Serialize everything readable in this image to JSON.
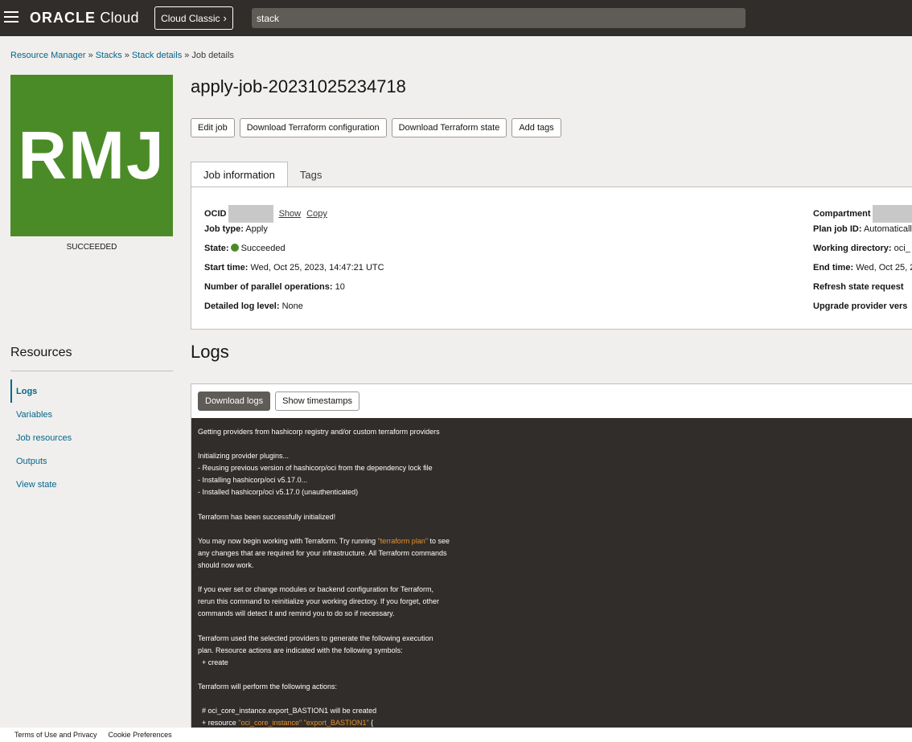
{
  "topbar": {
    "menu_icon": "hamburger-icon",
    "brand_oracle": "ORACLE",
    "brand_cloud": "Cloud",
    "classic_label": "Cloud Classic",
    "classic_icon": "chevron-right-icon",
    "search_value": "stack"
  },
  "breadcrumb": {
    "items": [
      "Resource Manager",
      "Stacks",
      "Stack details"
    ],
    "current": "Job details",
    "separator": "»"
  },
  "badge": {
    "text": "RMJ",
    "status": "SUCCEEDED",
    "color": "#4b8b27"
  },
  "title": "apply-job-20231025234718",
  "actions": [
    "Edit job",
    "Download Terraform configuration",
    "Download Terraform state",
    "Add tags"
  ],
  "tabs": [
    "Job information",
    "Tags"
  ],
  "job_info": {
    "ocid_label": "OCID",
    "show": "Show",
    "copy": "Copy",
    "job_type_label": "Job type:",
    "job_type": "Apply",
    "state_label": "State:",
    "state": "Succeeded",
    "start_label": "Start time:",
    "start": "Wed, Oct 25, 2023, 14:47:21 UTC",
    "parallel_label": "Number of parallel operations:",
    "parallel": "10",
    "log_level_label": "Detailed log level:",
    "log_level": "None",
    "compartment_label": "Compartment",
    "plan_label": "Plan job ID:",
    "plan": "Automatically",
    "workdir_label": "Working directory:",
    "workdir": "oci_",
    "end_label": "End time:",
    "end": "Wed, Oct 25, 2",
    "refresh_label": "Refresh state request",
    "upgrade_label": "Upgrade provider vers"
  },
  "resources": {
    "title": "Resources",
    "items": [
      "Logs",
      "Variables",
      "Job resources",
      "Outputs",
      "View state"
    ]
  },
  "logs": {
    "title": "Logs",
    "download": "Download logs",
    "timestamps": "Show timestamps",
    "lines": [
      "Getting providers from hashicorp registry and/or custom terraform providers",
      "",
      "Initializing provider plugins...",
      "- Reusing previous version of hashicorp/oci from the dependency lock file",
      "- Installing hashicorp/oci v5.17.0...",
      "- Installed hashicorp/oci v5.17.0 (unauthenticated)",
      "",
      "Terraform has been successfully initialized!",
      "",
      "You may now begin working with Terraform. Try running \"terraform plan\" to see",
      "any changes that are required for your infrastructure. All Terraform commands",
      "should now work.",
      "",
      "If you ever set or change modules or backend configuration for Terraform,",
      "rerun this command to reinitialize your working directory. If you forget, other",
      "commands will detect it and remind you to do so if necessary.",
      "",
      "Terraform used the selected providers to generate the following execution",
      "plan. Resource actions are indicated with the following symbols:",
      "  + create",
      "",
      "Terraform will perform the following actions:",
      "",
      "  # oci_core_instance.export_BASTION1 will be created",
      "  + resource \"oci_core_instance\" \"export_BASTION1\" {"
    ]
  },
  "footer": {
    "terms": "Terms of Use and Privacy",
    "cookies": "Cookie Preferences"
  }
}
